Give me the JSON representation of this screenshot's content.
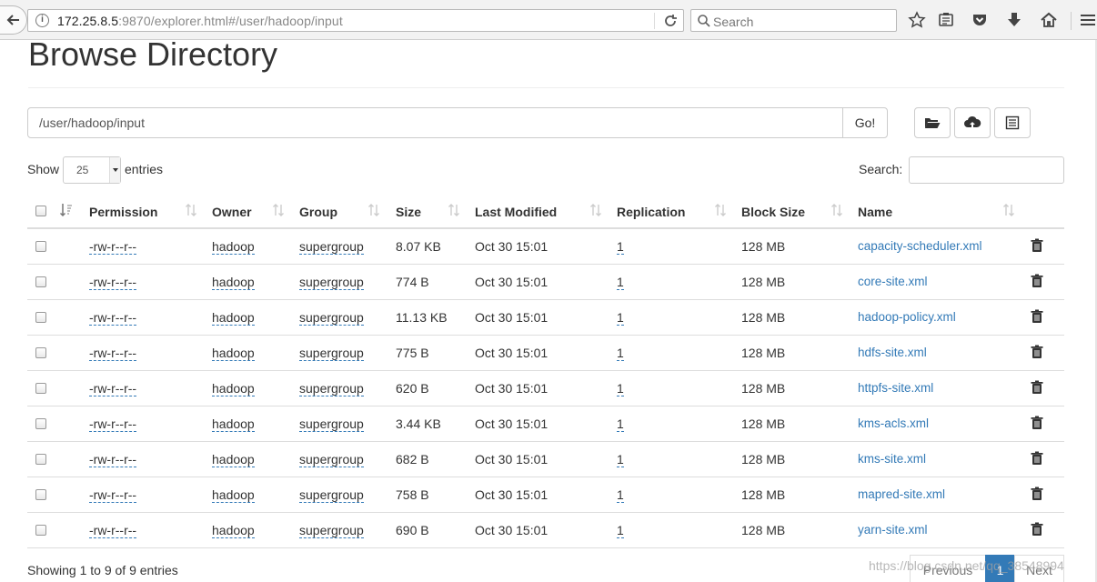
{
  "browser": {
    "url_host": "172.25.8.5",
    "url_rest": ":9870/explorer.html#/user/hadoop/input",
    "search_placeholder": "Search"
  },
  "page": {
    "title": "Browse Directory",
    "path_value": "/user/hadoop/input",
    "go_label": "Go!",
    "show_label": "Show",
    "entries_label": "entries",
    "page_length": "25",
    "search_label": "Search:",
    "info": "Showing 1 to 9 of 9 entries",
    "pager": {
      "previous": "Previous",
      "current": "1",
      "next": "Next"
    },
    "watermark": "https://blog.csdn.net/qq_38548994"
  },
  "table": {
    "headers": [
      "Permission",
      "Owner",
      "Group",
      "Size",
      "Last Modified",
      "Replication",
      "Block Size",
      "Name"
    ],
    "rows": [
      {
        "permission": "-rw-r--r--",
        "owner": "hadoop",
        "group": "supergroup",
        "size": "8.07 KB",
        "modified": "Oct 30 15:01",
        "replication": "1",
        "block": "128 MB",
        "name": "capacity-scheduler.xml"
      },
      {
        "permission": "-rw-r--r--",
        "owner": "hadoop",
        "group": "supergroup",
        "size": "774 B",
        "modified": "Oct 30 15:01",
        "replication": "1",
        "block": "128 MB",
        "name": "core-site.xml"
      },
      {
        "permission": "-rw-r--r--",
        "owner": "hadoop",
        "group": "supergroup",
        "size": "11.13 KB",
        "modified": "Oct 30 15:01",
        "replication": "1",
        "block": "128 MB",
        "name": "hadoop-policy.xml"
      },
      {
        "permission": "-rw-r--r--",
        "owner": "hadoop",
        "group": "supergroup",
        "size": "775 B",
        "modified": "Oct 30 15:01",
        "replication": "1",
        "block": "128 MB",
        "name": "hdfs-site.xml"
      },
      {
        "permission": "-rw-r--r--",
        "owner": "hadoop",
        "group": "supergroup",
        "size": "620 B",
        "modified": "Oct 30 15:01",
        "replication": "1",
        "block": "128 MB",
        "name": "httpfs-site.xml"
      },
      {
        "permission": "-rw-r--r--",
        "owner": "hadoop",
        "group": "supergroup",
        "size": "3.44 KB",
        "modified": "Oct 30 15:01",
        "replication": "1",
        "block": "128 MB",
        "name": "kms-acls.xml"
      },
      {
        "permission": "-rw-r--r--",
        "owner": "hadoop",
        "group": "supergroup",
        "size": "682 B",
        "modified": "Oct 30 15:01",
        "replication": "1",
        "block": "128 MB",
        "name": "kms-site.xml"
      },
      {
        "permission": "-rw-r--r--",
        "owner": "hadoop",
        "group": "supergroup",
        "size": "758 B",
        "modified": "Oct 30 15:01",
        "replication": "1",
        "block": "128 MB",
        "name": "mapred-site.xml"
      },
      {
        "permission": "-rw-r--r--",
        "owner": "hadoop",
        "group": "supergroup",
        "size": "690 B",
        "modified": "Oct 30 15:01",
        "replication": "1",
        "block": "128 MB",
        "name": "yarn-site.xml"
      }
    ]
  },
  "icons": {
    "toolbar": [
      "back-icon",
      "info-icon",
      "reload-icon",
      "search-icon",
      "bookmark-star-icon",
      "reader-icon",
      "pocket-icon",
      "download-icon",
      "home-icon",
      "menu-icon"
    ],
    "actions": [
      "folder-open-icon",
      "upload-cloud-icon",
      "list-alt-icon"
    ],
    "row": "trash-icon"
  },
  "colors": {
    "link": "#337ab7",
    "pager_active": "#337ab7"
  }
}
